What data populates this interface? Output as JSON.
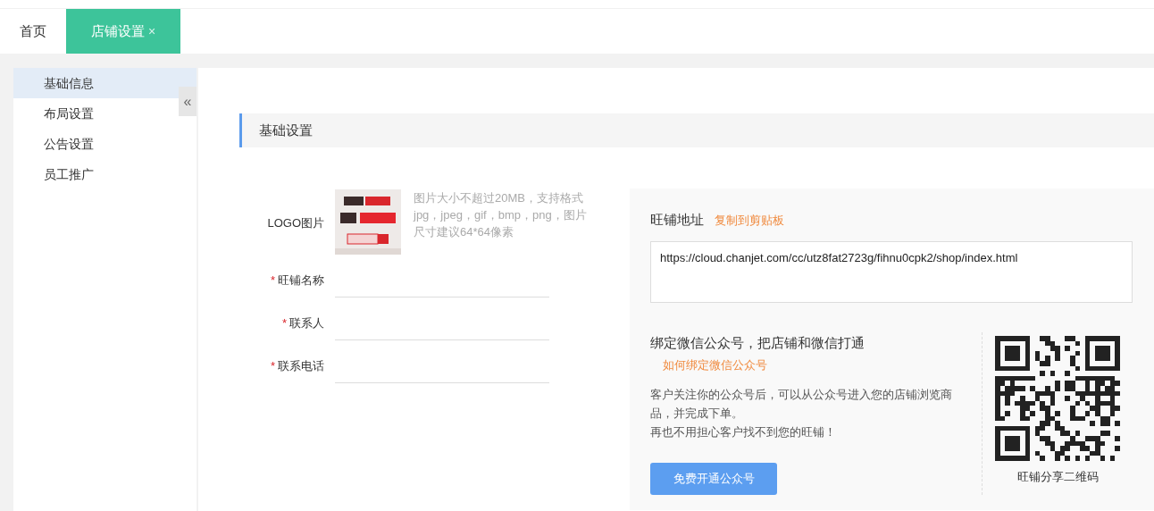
{
  "tabs": [
    {
      "label": "首页",
      "selected": false,
      "closable": false
    },
    {
      "label": "店铺设置",
      "selected": true,
      "closable": true,
      "close": "×"
    }
  ],
  "sidebar": {
    "items": [
      {
        "label": "基础信息",
        "selected": true
      },
      {
        "label": "布局设置",
        "selected": false
      },
      {
        "label": "公告设置",
        "selected": false
      },
      {
        "label": "员工推广",
        "selected": false
      }
    ],
    "collapse": "«"
  },
  "section_title": "基础设置",
  "form": {
    "logo": {
      "label": "LOGO图片",
      "hint": "图片大小不超过20MB，支持格式jpg，jpeg，gif，bmp，png，图片尺寸建议64*64像素"
    },
    "fields": [
      {
        "label": "旺铺名称",
        "required": true,
        "mark": "*"
      },
      {
        "label": "联系人",
        "required": true,
        "mark": "*"
      },
      {
        "label": "联系电话",
        "required": true,
        "mark": "*"
      }
    ]
  },
  "shop_address": {
    "label": "旺铺地址",
    "copy_link": "复制到剪贴板",
    "url": "https://cloud.chanjet.com/cc/utz8fat2723g/fihnu0cpk2/shop/index.html"
  },
  "wechat": {
    "title": "绑定微信公众号，把店铺和微信打通",
    "help_link": "如何绑定微信公众号",
    "paragraphs": [
      "客户关注你的公众号后，可以从公众号进入您的店铺浏览商品，并完成下单。",
      "再也不用担心客户找不到您的旺铺！"
    ],
    "button": "免费开通公众号",
    "qr_caption": "旺铺分享二维码"
  }
}
